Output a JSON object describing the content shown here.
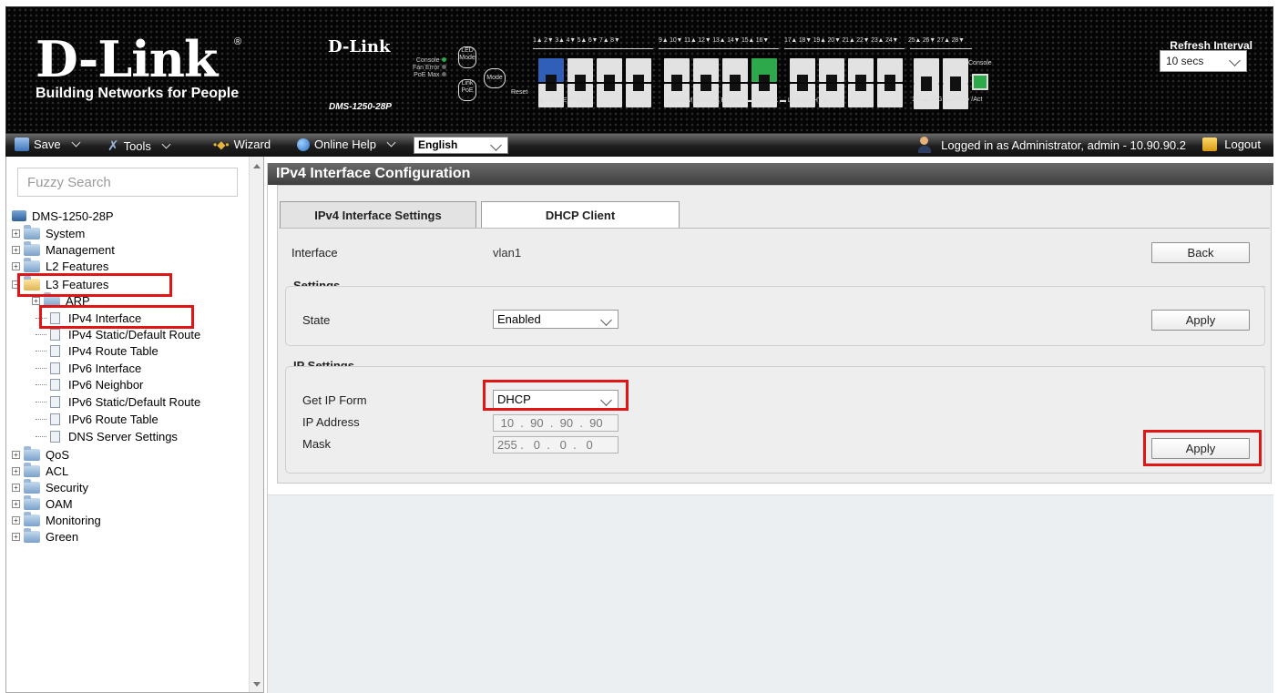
{
  "header": {
    "logo_brand": "D-Link",
    "logo_reg": "®",
    "logo_tagline": "Building Networks for People",
    "panel_brand": "D-Link",
    "panel_model": "DMS-1250-28P",
    "panel_leds": [
      "Console",
      "Fan Error",
      "PoE Max"
    ],
    "led_mode_label": "LED Mode",
    "link_poe_label": "Link PoE",
    "mode_label": "Mode",
    "reset_label": "Reset",
    "port_numbers": [
      "1▲ 2▼ 3▲ 4▼ 5▲ 6▼ 7▲ 8▼",
      "9▲ 10▼ 11▲ 12▼ 13▲ 14▼ 15▲ 16▼",
      "17▲ 18▼ 19▲ 20▼ 21▲ 22▼ 23▲ 24▼",
      "25▲ 26▼ 27▲ 28▼"
    ],
    "legend_left": "◀ LED LEFT  2.5G",
    "legend_mid": "10/100M ▬ 1G ▬   PoE Fail ▬  PoE OK ▬   LED RIGHT ▶",
    "legend_right": "1G ▬ 10G ▬ Link ● /Act",
    "console_label": "Console",
    "refresh_label": "Refresh Interval",
    "refresh_value": "10 secs"
  },
  "toolbar": {
    "save": "Save",
    "tools": "Tools",
    "wizard": "Wizard",
    "online_help": "Online Help",
    "language": "English",
    "login_text": "Logged in as Administrator, admin - 10.90.90.2",
    "logout": "Logout"
  },
  "sidebar": {
    "search_placeholder": "Fuzzy Search",
    "device": "DMS-1250-28P",
    "top_items": [
      "System",
      "Management",
      "L2 Features",
      "L3 Features"
    ],
    "l3_children": [
      "ARP",
      "IPv4 Interface",
      "IPv4 Static/Default Route",
      "IPv4 Route Table",
      "IPv6 Interface",
      "IPv6 Neighbor",
      "IPv6 Static/Default Route",
      "IPv6 Route Table",
      "DNS Server Settings"
    ],
    "bottom_items": [
      "QoS",
      "ACL",
      "Security",
      "OAM",
      "Monitoring",
      "Green"
    ]
  },
  "content": {
    "title": "IPv4 Interface Configuration",
    "tabs": [
      "IPv4 Interface Settings",
      "DHCP Client"
    ],
    "interface_label": "Interface",
    "interface_value": "vlan1",
    "back_button": "Back",
    "settings_title": "Settings",
    "state_label": "State",
    "state_value": "Enabled",
    "apply_button": "Apply",
    "ip_settings_title": "IP Settings",
    "get_ip_label": "Get IP Form",
    "get_ip_value": "DHCP",
    "ip_address_label": "IP Address",
    "ip_address_value": " 10  .  90  .  90  .  90",
    "mask_label": "Mask",
    "mask_value": "255 .   0  .   0  .   0",
    "apply_button_2": "Apply"
  },
  "colors": {
    "highlight": "#e01515",
    "header_bg": "#050505",
    "title_bar": "#4a4a4a"
  }
}
